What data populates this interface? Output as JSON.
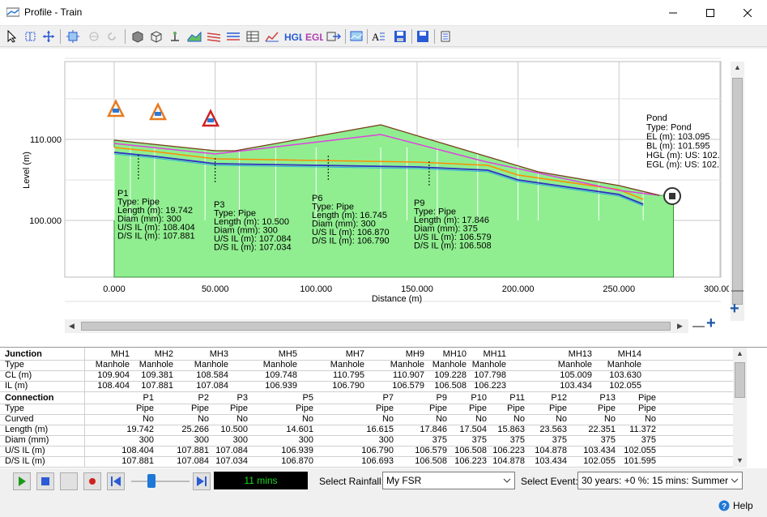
{
  "window": {
    "title": "Profile - Train"
  },
  "chart_data": {
    "type": "profile",
    "xlabel": "Distance (m)",
    "ylabel": "Level (m)",
    "x_ticks": [
      "0.000",
      "50.000",
      "100.000",
      "150.000",
      "200.000",
      "250.000",
      "300.000"
    ],
    "y_ticks": [
      "100.000",
      "110.000"
    ],
    "ground_level": [
      [
        0,
        109.9
      ],
      [
        50,
        108.6
      ],
      [
        60,
        108.6
      ],
      [
        132,
        111.8
      ],
      [
        183,
        108.0
      ],
      [
        210,
        106.0
      ],
      [
        250,
        104.3
      ],
      [
        270,
        103.1
      ]
    ],
    "hgl": [
      [
        0,
        109.5
      ],
      [
        50,
        108.2
      ],
      [
        132,
        110.6
      ],
      [
        183,
        107.3
      ],
      [
        250,
        103.7
      ],
      [
        270,
        103.1
      ]
    ],
    "pipe_labels": [
      {
        "name": "P1",
        "type": "Type: Pipe",
        "length": "Length (m): 19.742",
        "diam": "Diam (mm): 300",
        "us": "U/S IL (m): 108.404",
        "ds": "D/S IL (m): 107.881"
      },
      {
        "name": "P3",
        "type": "Type: Pipe",
        "length": "Length (m): 10.500",
        "diam": "Diam (mm): 300",
        "us": "U/S IL (m): 107.084",
        "ds": "D/S IL (m): 107.034"
      },
      {
        "name": "P6",
        "type": "Type: Pipe",
        "length": "Length (m): 16.745",
        "diam": "Diam (mm): 300",
        "us": "U/S IL (m): 106.870",
        "ds": "D/S IL (m): 106.790"
      },
      {
        "name": "P9",
        "type": "Type: Pipe",
        "length": "Length (m): 17.846",
        "diam": "Diam (mm): 375",
        "us": "U/S IL (m): 106.579",
        "ds": "D/S IL (m): 106.508"
      }
    ],
    "pond_label": [
      "Pond",
      "Type: Pond",
      "EL (m): 103.095",
      "BL (m): 101.595",
      "HGL (m): US: 102.",
      "EGL (m): US: 102."
    ]
  },
  "table": {
    "junction_header": "Junction",
    "junction_rows": [
      {
        "label": "",
        "cells": [
          "MH1",
          "MH2",
          "MH3",
          "MH5",
          "MH7",
          "MH9",
          "MH10",
          "MH11",
          "MH13",
          "MH14"
        ]
      },
      {
        "label": "Type",
        "cells": [
          "Manhole",
          "Manhole",
          "Manhole",
          "Manhole",
          "Manhole",
          "Manhole",
          "Manhole",
          "Manhole",
          "Manhole",
          "Manhole"
        ]
      },
      {
        "label": "CL (m)",
        "cells": [
          "109.904",
          "109.381",
          "108.584",
          "109.748",
          "110.795",
          "110.907",
          "109.228",
          "107.798",
          "105.009",
          "103.630"
        ]
      },
      {
        "label": "IL (m)",
        "cells": [
          "108.404",
          "107.881",
          "107.084",
          "106.939",
          "106.790",
          "106.579",
          "106.508",
          "106.223",
          "103.434",
          "102.055"
        ]
      }
    ],
    "connection_header": "Connection",
    "connection_names": [
      "P1",
      "P2",
      "P3",
      "P5",
      "P7",
      "P9",
      "P10",
      "P11",
      "P12",
      "P13",
      "Pipe"
    ],
    "connection_rows": [
      {
        "label": "Type",
        "cells": [
          "Pipe",
          "Pipe",
          "Pipe",
          "Pipe",
          "Pipe",
          "Pipe",
          "Pipe",
          "Pipe",
          "Pipe",
          "Pipe",
          "Pipe"
        ]
      },
      {
        "label": "Curved",
        "cells": [
          "No",
          "No",
          "No",
          "No",
          "No",
          "No",
          "No",
          "No",
          "No",
          "No",
          "No"
        ]
      },
      {
        "label": "Length (m)",
        "cells": [
          "19.742",
          "25.266",
          "10.500",
          "14.601",
          "16.615",
          "17.846",
          "17.504",
          "15.863",
          "23.563",
          "22.351",
          "11.372"
        ]
      },
      {
        "label": "Diam (mm)",
        "cells": [
          "300",
          "300",
          "300",
          "300",
          "300",
          "375",
          "375",
          "375",
          "375",
          "375",
          "375"
        ]
      },
      {
        "label": "U/S IL (m)",
        "cells": [
          "108.404",
          "107.881",
          "107.084",
          "106.939",
          "106.790",
          "106.579",
          "106.508",
          "106.223",
          "104.878",
          "103.434",
          "102.055"
        ]
      },
      {
        "label": "D/S IL (m)",
        "cells": [
          "107.881",
          "107.084",
          "107.034",
          "106.870",
          "106.693",
          "106.508",
          "106.223",
          "104.878",
          "103.434",
          "102.055",
          "101.595"
        ]
      }
    ]
  },
  "controls": {
    "time": "11 mins",
    "rainfall_label": "Select Rainfall:",
    "rainfall_value": "My FSR",
    "event_label": "Select Event:",
    "event_value": "30 years: +0 %: 15 mins: Summer",
    "help": "Help"
  },
  "colors": {
    "ground": "#90ee90",
    "hgl": "#e040e0",
    "soffit": "#ff8c00",
    "invert": "#3030c0"
  }
}
